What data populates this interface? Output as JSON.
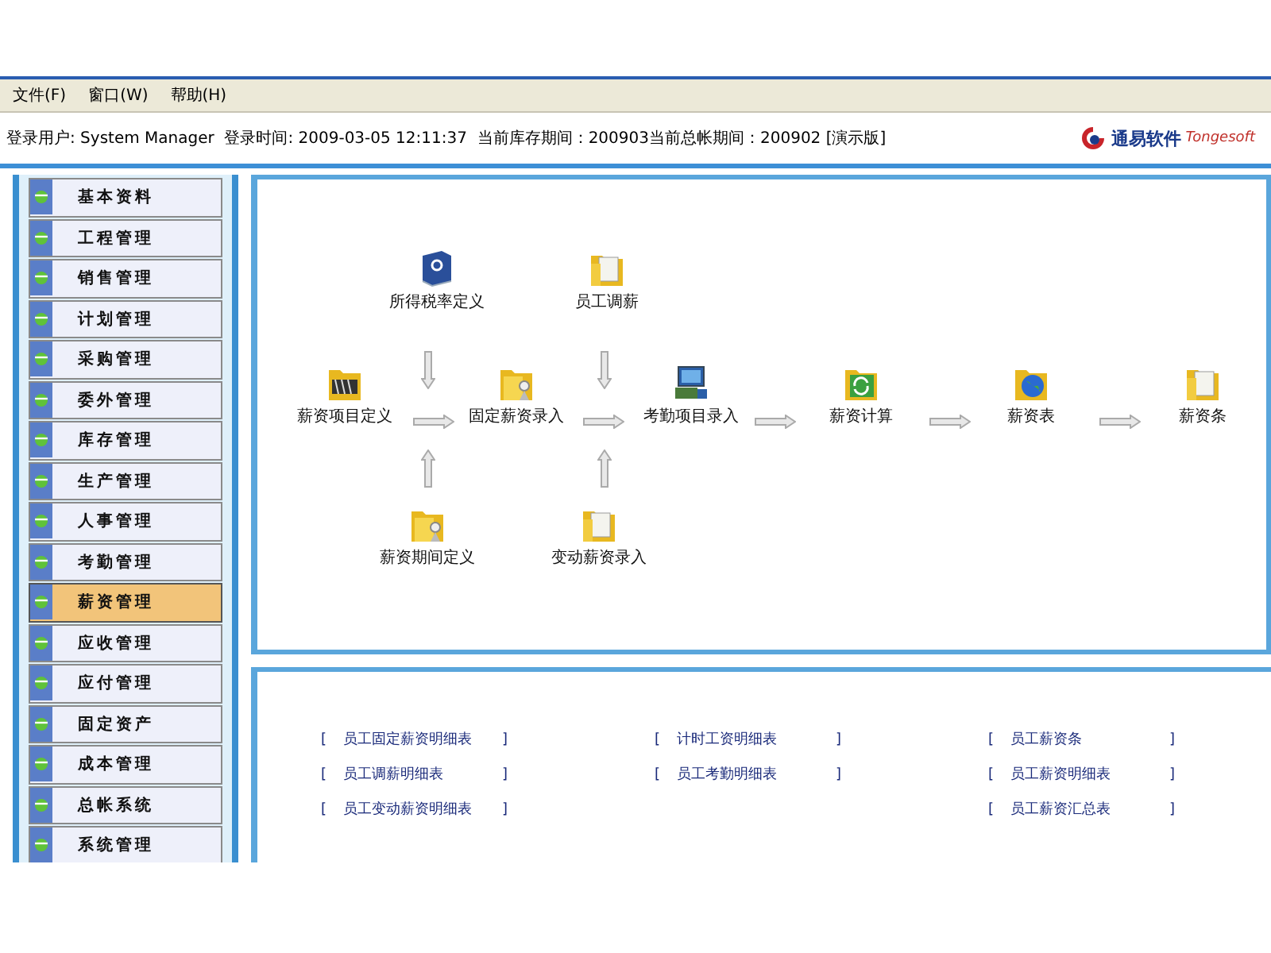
{
  "menu": [
    {
      "label": "文件(F)"
    },
    {
      "label": "窗口(W)"
    },
    {
      "label": "帮助(H)"
    }
  ],
  "info_bar": {
    "text": "登录用户: System Manager  登录时间: 2009-03-05 12:11:37  当前库存期间：200903当前总帐期间：200902 [演示版]",
    "logo_name": "通易软件",
    "logo_latin": "Tongesoft"
  },
  "sidebar": {
    "items": [
      {
        "label": "基本资料",
        "selected": false
      },
      {
        "label": "工程管理",
        "selected": false
      },
      {
        "label": "销售管理",
        "selected": false
      },
      {
        "label": "计划管理",
        "selected": false
      },
      {
        "label": "采购管理",
        "selected": false
      },
      {
        "label": "委外管理",
        "selected": false
      },
      {
        "label": "库存管理",
        "selected": false
      },
      {
        "label": "生产管理",
        "selected": false
      },
      {
        "label": "人事管理",
        "selected": false
      },
      {
        "label": "考勤管理",
        "selected": false
      },
      {
        "label": "薪资管理",
        "selected": true
      },
      {
        "label": "应收管理",
        "selected": false
      },
      {
        "label": "应付管理",
        "selected": false
      },
      {
        "label": "固定资产",
        "selected": false
      },
      {
        "label": "成本管理",
        "selected": false
      },
      {
        "label": "总帐系统",
        "selected": false
      },
      {
        "label": "系统管理",
        "selected": false
      }
    ]
  },
  "flow": {
    "nodes": [
      {
        "label": "所得税率定义",
        "kind": "book"
      },
      {
        "label": "员工调薪",
        "kind": "folder-doc"
      },
      {
        "label": "薪资项目定义",
        "kind": "folder-film"
      },
      {
        "label": "固定薪资录入",
        "kind": "folder-person"
      },
      {
        "label": "考勤项目录入",
        "kind": "computer"
      },
      {
        "label": "薪资计算",
        "kind": "folder-refresh"
      },
      {
        "label": "薪资表",
        "kind": "folder-globe"
      },
      {
        "label": "薪资条",
        "kind": "folder-doc"
      },
      {
        "label": "薪资期间定义",
        "kind": "folder-person"
      },
      {
        "label": "变动薪资录入",
        "kind": "folder-doc"
      }
    ]
  },
  "reports": {
    "columns": [
      [
        {
          "open": "[",
          "label": "员工固定薪资明细表",
          "close": "]"
        },
        {
          "open": "[",
          "label": "员工调薪明细表",
          "close": "]"
        },
        {
          "open": "[",
          "label": "员工变动薪资明细表",
          "close": "]"
        }
      ],
      [
        {
          "open": "[",
          "label": "计时工资明细表",
          "close": "]"
        },
        {
          "open": "[",
          "label": "员工考勤明细表",
          "close": "]"
        }
      ],
      [
        {
          "open": "[",
          "label": "员工薪资条",
          "close": "]"
        },
        {
          "open": "[",
          "label": "员工薪资明细表",
          "close": "]"
        },
        {
          "open": "[",
          "label": "员工薪资汇总表",
          "close": "]"
        }
      ]
    ]
  }
}
